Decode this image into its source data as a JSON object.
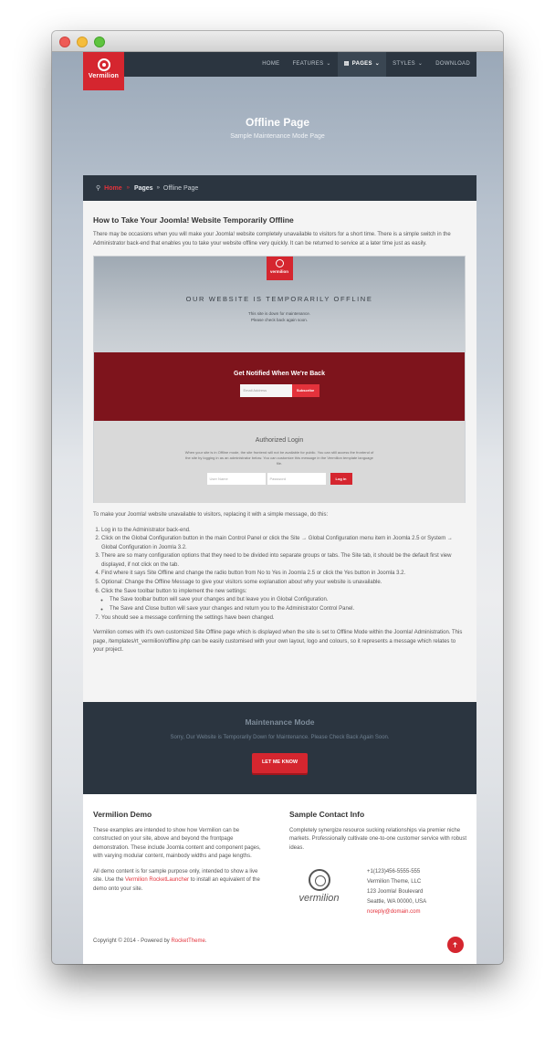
{
  "nav": {
    "logo_text": "Vermilion",
    "items": [
      {
        "label": "HOME",
        "caret": false,
        "page_icon": false
      },
      {
        "label": "FEATURES",
        "caret": true,
        "page_icon": false
      },
      {
        "label": "PAGES",
        "caret": true,
        "page_icon": true,
        "active": true
      },
      {
        "label": "STYLES",
        "caret": true,
        "page_icon": false
      },
      {
        "label": "DOWNLOAD",
        "caret": false,
        "page_icon": false
      }
    ]
  },
  "hero": {
    "title": "Offline Page",
    "subtitle": "Sample Maintenance Mode Page"
  },
  "breadcrumb": {
    "home": "Home",
    "pages": "Pages",
    "current": "Offline Page"
  },
  "article": {
    "title": "How to Take Your Joomla! Website Temporarily Offline",
    "intro": "There may be occasions when you will make your Joomla! website completely unavailable to visitors for a short time. There is a simple switch in the Administrator back-end that enables you to take your website offline very quickly. It can be returned to service at a later time just as easily.",
    "screenshot": {
      "logo_text": "vermilion",
      "heading": "OUR WEBSITE IS TEMPORARILY OFFLINE",
      "line1": "This site is down for maintenance.",
      "line2": "Please check back again soon.",
      "notify_title": "Get Notified When We're Back",
      "email_placeholder": "Email Address",
      "subscribe_label": "Subscribe",
      "login_title": "Authorized Login",
      "login_text": "When your site is in Offline mode, the site frontend will not be available for public. You can still access the frontend of the site by logging in as an administrator below. You can customize this message in the Vermilion template language file.",
      "username_placeholder": "User Name",
      "password_placeholder": "Password",
      "login_label": "Log in"
    },
    "lead": "To make your Joomla! website unavailable to visitors, replacing it with a simple message, do this:",
    "steps": [
      "Log in to the Administrator back-end.",
      "Click on the Global Configuration button in the main Control Panel or click the Site → Global Configuration menu item in Joomla 2.5 or System → Global Configuration in Joomla 3.2.",
      "There are so many configuration options that they need to be divided into separate groups or tabs. The Site tab, it should be the default first view displayed, if not click on the tab.",
      "Find where it says Site Offline and change the radio button from No to Yes in Joomla 2.5 or click the Yes button in Joomla 3.2.",
      "Optional: Change the Offline Message to give your visitors some explanation about why your website is unavailable.",
      "Click the Save toolbar button to implement the new settings:",
      "You should see a message confirming the settings have been changed."
    ],
    "substeps": [
      "The Save toolbar button will save your changes and but leave you in Global Configuration.",
      "The Save and Close button will save your changes and return you to the Administrator Control Panel."
    ],
    "outro": "Vermilion comes with it's own customized Site Offline page which is displayed when the site is set to Offline Mode within the Joomla! Administration. This page, /templates/rt_vermilion/offline.php can be easily customised with your own layout, logo and colours, so it represents a message which relates to your project."
  },
  "maintenance": {
    "title": "Maintenance Mode",
    "text": "Sorry, Our Website is Temporarily Down for Maintenance. Please Check Back Again Soon.",
    "button": "LET ME KNOW"
  },
  "footer": {
    "demo_title": "Vermilion Demo",
    "demo_p1": "These examples are intended to show how Vermilion can be constructed on your site, above and beyond the frontpage demonstration. These include Joomla content and component pages, with varying modular content, mainbody widths and page lengths.",
    "demo_p2_a": "All demo content is for sample purpose only, intended to show a live site. Use the ",
    "demo_p2_link": "Vermilion RocketLauncher",
    "demo_p2_b": " to install an equivalent of the demo onto your site.",
    "contact_title": "Sample Contact Info",
    "contact_text": "Completely synergize resource sucking relationships via premier niche markets. Professionally cultivate one-to-one customer service with robust ideas.",
    "contact_logo": "vermilion",
    "phone": "+1(123)456-5555-555",
    "company": "Vermilion Theme, LLC",
    "street": "123 Joomla! Boulevard",
    "city": "Seattle, WA 00000, USA",
    "email": "noreply@domain.com",
    "copyright_text": "Copyright © 2014 - Powered by ",
    "copyright_link": "RocketTheme",
    "copyright_end": ".",
    "top_icon": "arrow-up-icon"
  }
}
